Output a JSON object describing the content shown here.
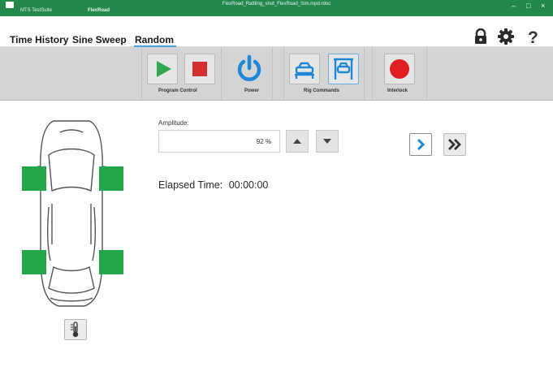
{
  "titlebar": {
    "app_name": "MTS TestSuite",
    "workspace": "FlexRoad",
    "document": "FlexRoad_Rattling_shot_FlexRoad_Sim.mpd.rdoc"
  },
  "tabs": [
    {
      "label": "Time History"
    },
    {
      "label": "Sine Sweep"
    },
    {
      "label": "Random",
      "active": true
    }
  ],
  "toolbar": {
    "program_control_label": "Program Control",
    "power_label": "Power",
    "rig_commands_label": "Rig Commands",
    "interlock_label": "Interlock"
  },
  "amplitude": {
    "label": "Amplitude:",
    "value": "92 %"
  },
  "elapsed": {
    "label": "Elapsed Time:",
    "value": "00:00:00"
  },
  "colors": {
    "titlebar": "#22894a",
    "wheel": "#22a84a",
    "power": "#1e88d6",
    "interlock": "#e02020",
    "stop": "#d32f2f",
    "play": "#2fa84f"
  },
  "icons": [
    "lock-icon",
    "gear-icon",
    "help-icon",
    "play-icon",
    "stop-icon",
    "power-icon",
    "lift-down-icon",
    "lift-up-icon",
    "interlock-icon",
    "arrow-up-icon",
    "arrow-down-icon",
    "chevron-right-icon",
    "double-chevron-right-icon",
    "thermometer-icon"
  ]
}
